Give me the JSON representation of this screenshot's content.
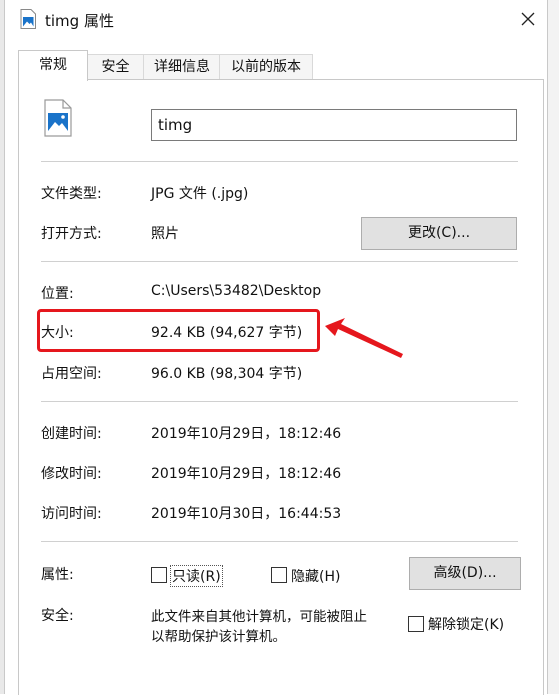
{
  "window": {
    "title": "timg 属性",
    "close_icon": "close-icon"
  },
  "tabs": [
    {
      "label": "常规",
      "active": true
    },
    {
      "label": "安全",
      "active": false
    },
    {
      "label": "详细信息",
      "active": false
    },
    {
      "label": "以前的版本",
      "active": false
    }
  ],
  "general": {
    "file_name": "timg",
    "rows": {
      "type_label": "文件类型:",
      "type_value": "JPG 文件 (.jpg)",
      "open_label": "打开方式:",
      "open_value": "照片",
      "change_button": "更改(C)...",
      "location_label": "位置:",
      "location_value": "C:\\Users\\53482\\Desktop",
      "size_label": "大小:",
      "size_value": "92.4 KB (94,627 字节)",
      "disk_label": "占用空间:",
      "disk_value": "96.0 KB (98,304 字节)",
      "created_label": "创建时间:",
      "created_value": "2019年10月29日，18:12:46",
      "modified_label": "修改时间:",
      "modified_value": "2019年10月29日，18:12:46",
      "accessed_label": "访问时间:",
      "accessed_value": "2019年10月30日，16:44:53"
    },
    "attributes": {
      "label": "属性:",
      "readonly": "只读(R)",
      "hidden": "隐藏(H)",
      "advanced_button": "高级(D)..."
    },
    "security": {
      "label": "安全:",
      "message_line1": "此文件来自其他计算机，可能被阻止",
      "message_line2": "以帮助保护该计算机。",
      "unblock": "解除锁定(K)"
    }
  },
  "colors": {
    "annotation": "#e5171d",
    "icon_blue": "#1a73c9"
  }
}
